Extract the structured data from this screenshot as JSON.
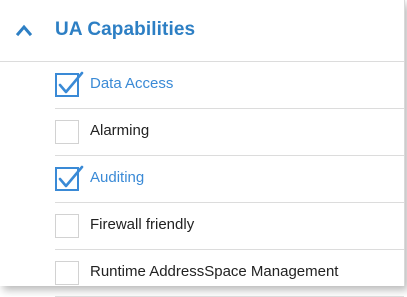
{
  "section": {
    "title": "UA Capabilities",
    "expanded": true,
    "accent_color": "#2d7fc4"
  },
  "capabilities": [
    {
      "label": "Data Access",
      "checked": true
    },
    {
      "label": "Alarming",
      "checked": false
    },
    {
      "label": "Auditing",
      "checked": true
    },
    {
      "label": "Firewall friendly",
      "checked": false
    },
    {
      "label": "Runtime AddressSpace Management",
      "checked": false
    }
  ],
  "icons": {
    "toggle": "chevron-up-icon",
    "check": "checkmark-icon"
  }
}
